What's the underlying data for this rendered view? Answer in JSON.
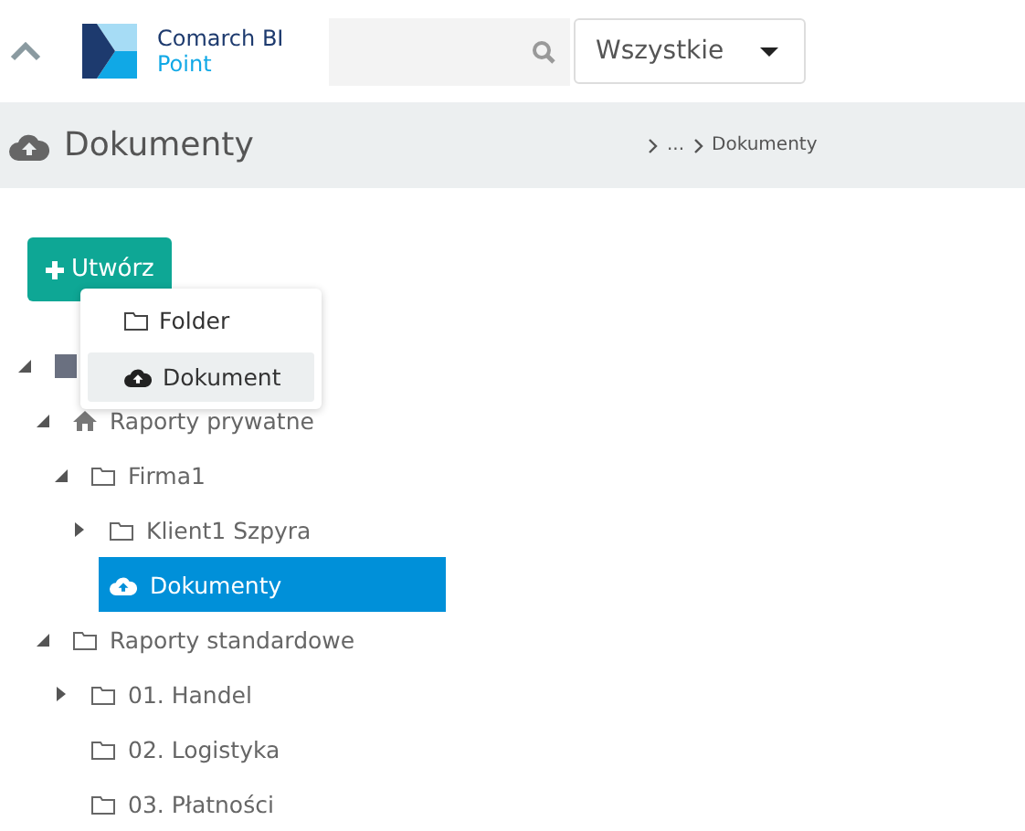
{
  "header": {
    "brand": "Comarch BI",
    "product": "Point",
    "scope": "Wszystkie"
  },
  "page": {
    "title": "Dokumenty",
    "breadcrumb": [
      "...",
      "Dokumenty"
    ]
  },
  "create_button": "Utwórz",
  "create_menu": [
    {
      "label": "Folder",
      "kind": "folder",
      "selected": false
    },
    {
      "label": "Dokument",
      "kind": "document",
      "selected": true
    }
  ],
  "tree": [
    {
      "kind": "root",
      "expanded": true,
      "selected": false,
      "children": [
        {
          "label": "Raporty prywatne",
          "kind": "home",
          "expanded": true,
          "selected": false,
          "children": [
            {
              "label": "Firma1",
              "kind": "folder",
              "expanded": true,
              "selected": false,
              "children": [
                {
                  "label": "Klient1 Szpyra",
                  "kind": "folder",
                  "expanded": false,
                  "selected": false
                },
                {
                  "label": "Dokumenty",
                  "kind": "documents",
                  "selected": true
                }
              ]
            }
          ]
        },
        {
          "label": "Raporty standardowe",
          "kind": "folder",
          "expanded": true,
          "selected": false,
          "children": [
            {
              "label": "01. Handel",
              "kind": "folder",
              "expanded": false,
              "selected": false
            },
            {
              "label": "02. Logistyka",
              "kind": "folder",
              "selected": false
            },
            {
              "label": "03. Płatności",
              "kind": "folder",
              "selected": false
            }
          ]
        }
      ]
    }
  ]
}
